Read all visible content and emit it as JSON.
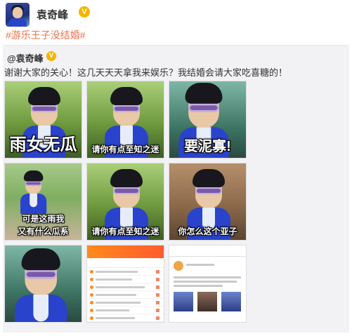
{
  "header": {
    "username": "袁奇峰",
    "verified_badge": "V"
  },
  "topic": "#游乐王子没结婚#",
  "repost": {
    "username": "@袁奇峰",
    "verified_badge": "V",
    "text": "谢谢大家的关心！这几天天天拿我来娱乐？我结婚会请大家吃喜糖的！"
  },
  "images": [
    {
      "caption": "雨女无瓜"
    },
    {
      "caption": "请你有点至知之迷"
    },
    {
      "caption": "要泥寡!"
    },
    {
      "caption_line1": "可是这雨我",
      "caption_line2": "又有什么瓜系"
    },
    {
      "caption": "请你有点至知之迷"
    },
    {
      "caption": "你怎么这个亚子"
    }
  ],
  "colors": {
    "topic": "#eb7350",
    "verified": "#f5b400",
    "costume_blue": "#2a43cc"
  }
}
